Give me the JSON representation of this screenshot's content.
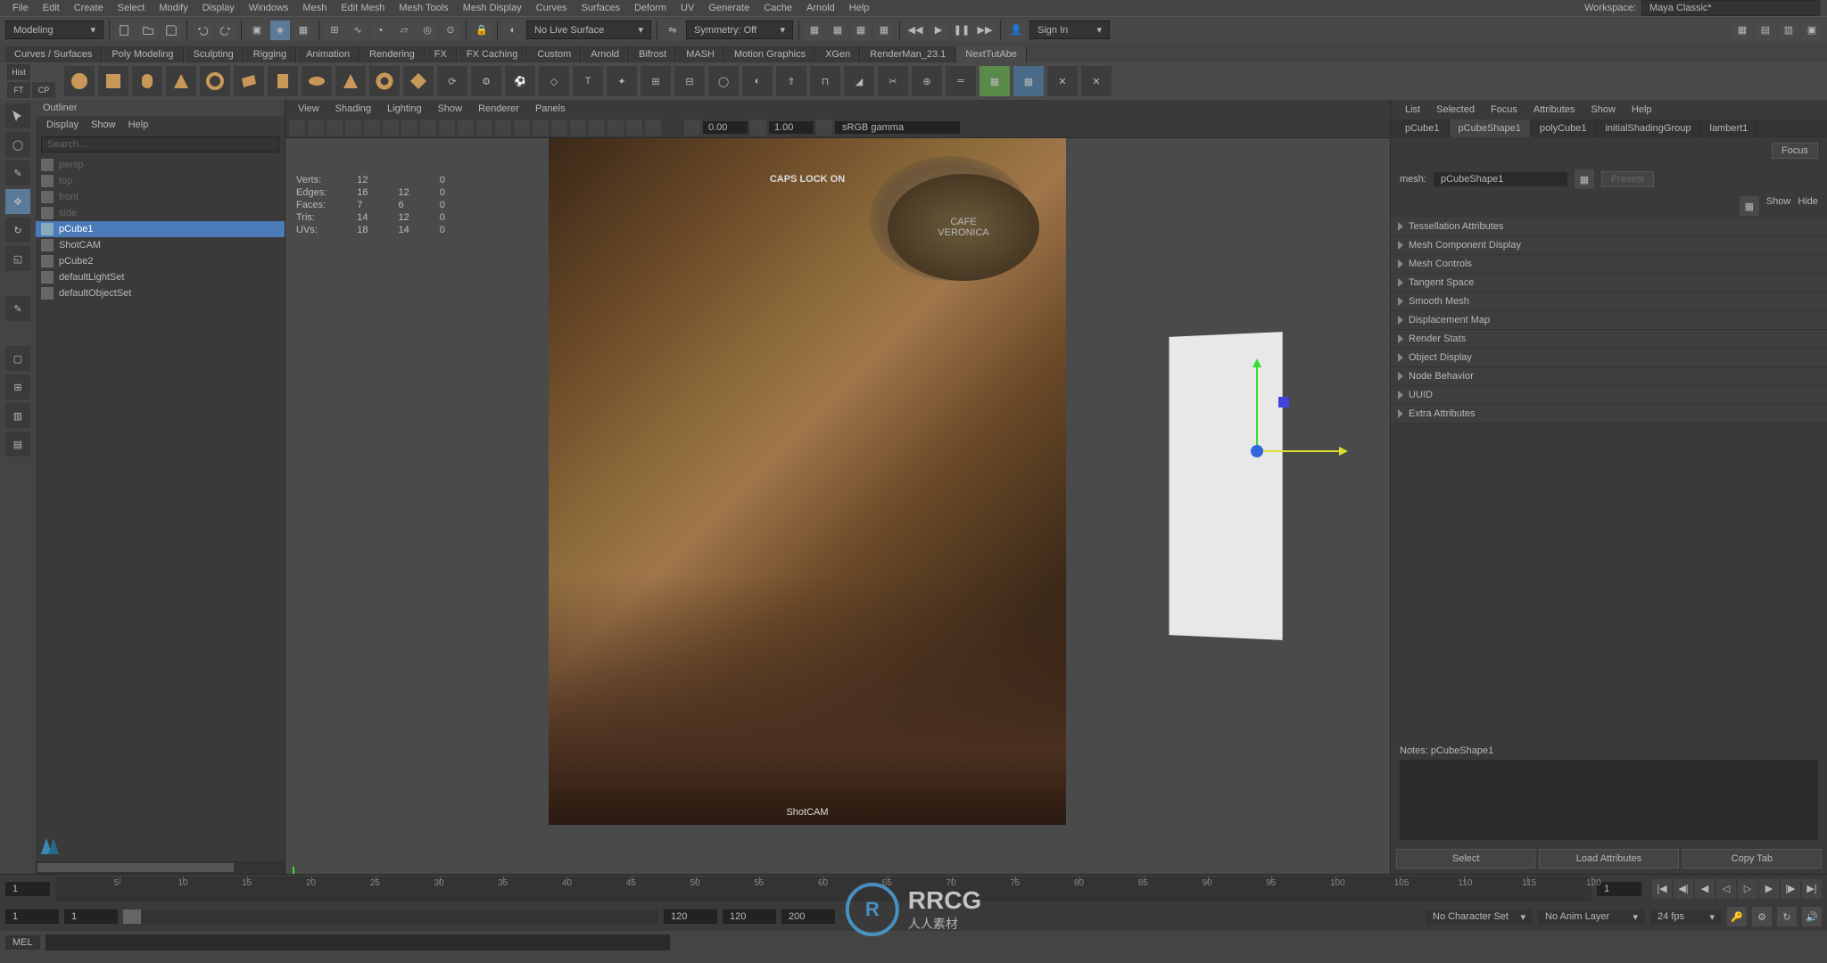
{
  "workspace": {
    "label": "Workspace:",
    "value": "Maya Classic*"
  },
  "menubar": [
    "File",
    "Edit",
    "Create",
    "Select",
    "Modify",
    "Display",
    "Windows",
    "Mesh",
    "Edit Mesh",
    "Mesh Tools",
    "Mesh Display",
    "Curves",
    "Surfaces",
    "Deform",
    "UV",
    "Generate",
    "Cache",
    "Arnold",
    "Help"
  ],
  "toolbar": {
    "mode_dropdown": "Modeling",
    "live_surface": "No Live Surface",
    "symmetry": "Symmetry: Off",
    "signin": "Sign In"
  },
  "shelf_tabs": [
    "Curves / Surfaces",
    "Poly Modeling",
    "Sculpting",
    "Rigging",
    "Animation",
    "Rendering",
    "FX",
    "FX Caching",
    "Custom",
    "Arnold",
    "Bifrost",
    "MASH",
    "Motion Graphics",
    "XGen",
    "RenderMan_23.1",
    "NextTutAbe"
  ],
  "shelf_tabs_active": 15,
  "shelf_toggles": [
    "Hist",
    "FT",
    "CP"
  ],
  "outliner": {
    "title": "Outliner",
    "menus": [
      "Display",
      "Show",
      "Help"
    ],
    "search_placeholder": "Search...",
    "items": [
      {
        "label": "persp",
        "sel": false,
        "dim": true
      },
      {
        "label": "top",
        "sel": false,
        "dim": true
      },
      {
        "label": "front",
        "sel": false,
        "dim": true
      },
      {
        "label": "side",
        "sel": false,
        "dim": true
      },
      {
        "label": "pCube1",
        "sel": true,
        "dim": false
      },
      {
        "label": "ShotCAM",
        "sel": false,
        "dim": false
      },
      {
        "label": "pCube2",
        "sel": false,
        "dim": false
      },
      {
        "label": "defaultLightSet",
        "sel": false,
        "dim": false
      },
      {
        "label": "defaultObjectSet",
        "sel": false,
        "dim": false
      }
    ]
  },
  "viewport": {
    "menus": [
      "View",
      "Shading",
      "Lighting",
      "Show",
      "Renderer",
      "Panels"
    ],
    "gate_val1": "0.00",
    "gate_val2": "1.00",
    "renderspace": "sRGB gamma",
    "caps_text": "CAPS LOCK ON",
    "cam_label": "ShotCAM",
    "sign_line1": "CAFE",
    "sign_line2": "VERONICA"
  },
  "hud_stats": [
    {
      "label": "Verts:",
      "a": "12",
      "b": "0"
    },
    {
      "label": "Edges:",
      "a": "16",
      "b": "12",
      "c": "0"
    },
    {
      "label": "Faces:",
      "a": "7",
      "b": "6",
      "c": "0"
    },
    {
      "label": "Tris:",
      "a": "14",
      "b": "12",
      "c": "0"
    },
    {
      "label": "UVs:",
      "a": "18",
      "b": "14",
      "c": "0"
    }
  ],
  "attr": {
    "menus": [
      "List",
      "Selected",
      "Focus",
      "Attributes",
      "Show",
      "Help"
    ],
    "tabs": [
      "pCube1",
      "pCubeShape1",
      "polyCube1",
      "initialShadingGroup",
      "lambert1"
    ],
    "active_tab": 1,
    "focus_btn": "Focus",
    "presets_btn": "Presets",
    "show_btn": "Show",
    "hide_btn": "Hide",
    "mesh_label": "mesh:",
    "mesh_value": "pCubeShape1",
    "sections": [
      "Tessellation Attributes",
      "Mesh Component Display",
      "Mesh Controls",
      "Tangent Space",
      "Smooth Mesh",
      "Displacement Map",
      "Render Stats",
      "Object Display",
      "Node Behavior",
      "UUID",
      "Extra Attributes"
    ],
    "notes_label": "Notes: pCubeShape1",
    "buttons": [
      "Select",
      "Load Attributes",
      "Copy Tab"
    ]
  },
  "timeline": {
    "start_field": "1",
    "end_field": "1",
    "range_start": "1",
    "range_inner_start": "1",
    "range_inner_end": "120",
    "range_end": "120",
    "range_end2": "200",
    "ticks": [
      5,
      10,
      15,
      20,
      25,
      30,
      35,
      40,
      45,
      50,
      55,
      60,
      65,
      70,
      75,
      80,
      85,
      90,
      95,
      100,
      105,
      110,
      115,
      120
    ],
    "char_set": "No Character Set",
    "anim_layer": "No Anim Layer",
    "fps": "24 fps"
  },
  "cmd": {
    "label": "MEL"
  },
  "watermark": {
    "text": "RRCG",
    "sub": "人人素材"
  }
}
